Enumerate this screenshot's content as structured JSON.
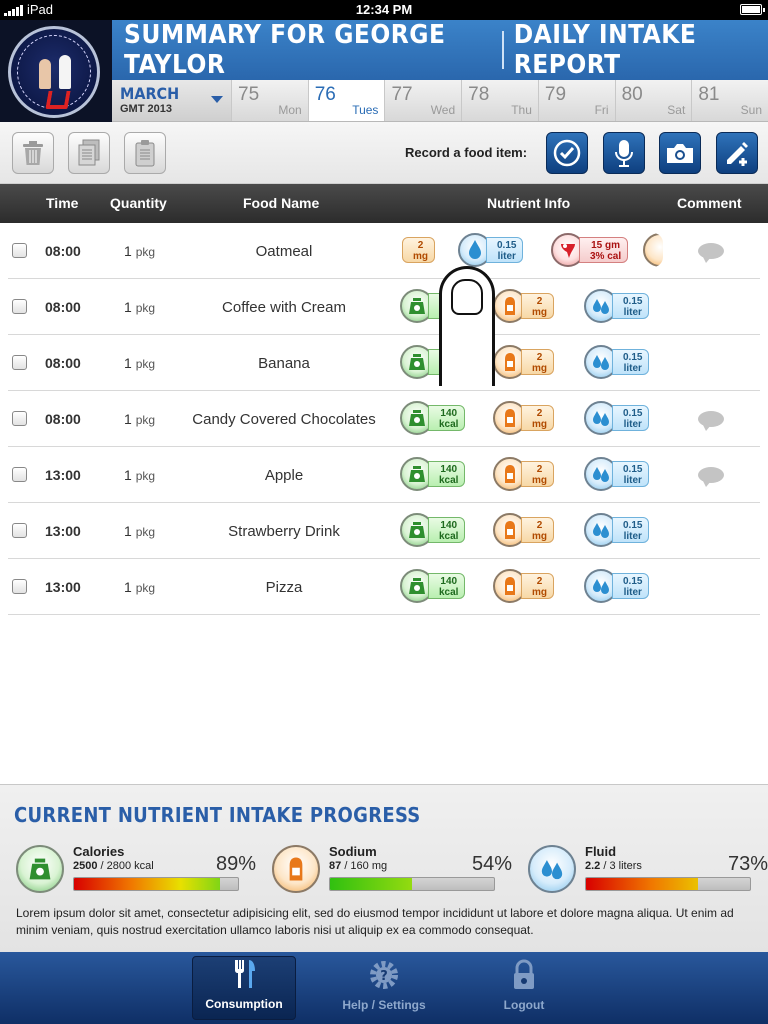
{
  "status_bar": {
    "carrier": "iPad",
    "time": "12:34 PM"
  },
  "header": {
    "title_left": "SUMMARY FOR GEORGE TAYLOR",
    "title_right": "DAILY INTAKE REPORT",
    "month": "MARCH",
    "month_sub": "GMT 2013",
    "days": [
      {
        "num": "75",
        "label": "Mon"
      },
      {
        "num": "76",
        "label": "Tues",
        "selected": true
      },
      {
        "num": "77",
        "label": "Wed"
      },
      {
        "num": "78",
        "label": "Thu"
      },
      {
        "num": "79",
        "label": "Fri"
      },
      {
        "num": "80",
        "label": "Sat"
      },
      {
        "num": "81",
        "label": "Sun"
      }
    ]
  },
  "toolbar": {
    "record_label": "Record a food item:",
    "left_icons": [
      "trash-icon",
      "copy-icon",
      "clipboard-icon"
    ],
    "right_icons": [
      "check-icon",
      "microphone-icon",
      "camera-icon",
      "edit-add-icon"
    ]
  },
  "table": {
    "columns": [
      "Time",
      "Quantity",
      "Food Name",
      "Nutrient Info",
      "Comment"
    ],
    "unit": "pkg",
    "rows": [
      {
        "time": "08:00",
        "qty": "1",
        "food": "Oatmeal",
        "comment": true
      },
      {
        "time": "08:00",
        "qty": "1",
        "food": "Coffee with Cream",
        "comment": false
      },
      {
        "time": "08:00",
        "qty": "1",
        "food": "Banana",
        "comment": false
      },
      {
        "time": "08:00",
        "qty": "1",
        "food": "Candy Covered Chocolates",
        "comment": true
      },
      {
        "time": "13:00",
        "qty": "1",
        "food": "Apple",
        "comment": true
      },
      {
        "time": "13:00",
        "qty": "1",
        "food": "Strawberry Drink",
        "comment": false
      },
      {
        "time": "13:00",
        "qty": "1",
        "food": "Pizza",
        "comment": false
      }
    ],
    "nutrients": {
      "calories": {
        "value": "140",
        "unit": "kcal"
      },
      "sodium": {
        "value": "2",
        "unit": "mg"
      },
      "fluid": {
        "value": "0.15",
        "unit": "liter"
      },
      "protein": {
        "value": "15 gm",
        "unit": "3% cal"
      }
    }
  },
  "progress": {
    "title": "CURRENT NUTRIENT INTAKE PROGRESS",
    "items": [
      {
        "name": "Calories",
        "current": "2500",
        "total": "/ 2800 kcal",
        "percent": "89%",
        "fraction": 0.89
      },
      {
        "name": "Sodium",
        "current": "87",
        "total": "/ 160 mg",
        "percent": "54%",
        "fraction": 0.5
      },
      {
        "name": "Fluid",
        "current": "2.2",
        "total": "/ 3 liters",
        "percent": "73%",
        "fraction": 0.68
      }
    ],
    "description": "Lorem ipsum dolor sit amet, consectetur adipisicing elit, sed do eiusmod tempor incididunt ut labore et dolore magna aliqua. Ut enim ad minim veniam, quis nostrud exercitation ullamco laboris nisi ut aliquip ex ea commodo consequat."
  },
  "tabbar": {
    "tabs": [
      {
        "label": "Consumption",
        "icon": "fork-knife-icon",
        "active": true
      },
      {
        "label": "Help / Settings",
        "icon": "gear-icon",
        "active": false
      },
      {
        "label": "Logout",
        "icon": "lock-icon",
        "active": false
      }
    ]
  },
  "colors": {
    "accent": "#2a5ea8",
    "header_blue": "#3b83c9",
    "tab_bar": "#1b427f"
  }
}
